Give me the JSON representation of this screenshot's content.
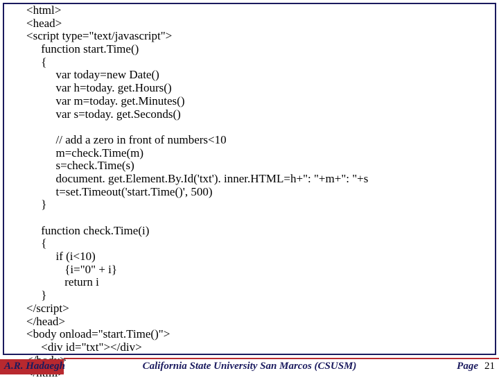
{
  "code": "<html>\n<head>\n<script type=\"text/javascript\">\n     function start.Time()\n     {\n          var today=new Date()\n          var h=today. get.Hours()\n          var m=today. get.Minutes()\n          var s=today. get.Seconds()\n\n          // add a zero in front of numbers<10\n          m=check.Time(m)\n          s=check.Time(s)\n          document. get.Element.By.Id('txt'). inner.HTML=h+\": \"+m+\": \"+s\n          t=set.Timeout('start.Time()', 500)\n     }\n\n     function check.Time(i)\n     {\n          if (i<10)\n             {i=\"0\" + i}\n             return i\n     }\n</script>\n</head>\n<body onload=\"start.Time()\">\n     <div id=\"txt\"></div>\n</body>\n</html>",
  "footer": {
    "author": "A.R. Hadaegh",
    "center": "California State University San Marcos (CSUSM)",
    "page_label": "Page",
    "page_number": "21"
  }
}
